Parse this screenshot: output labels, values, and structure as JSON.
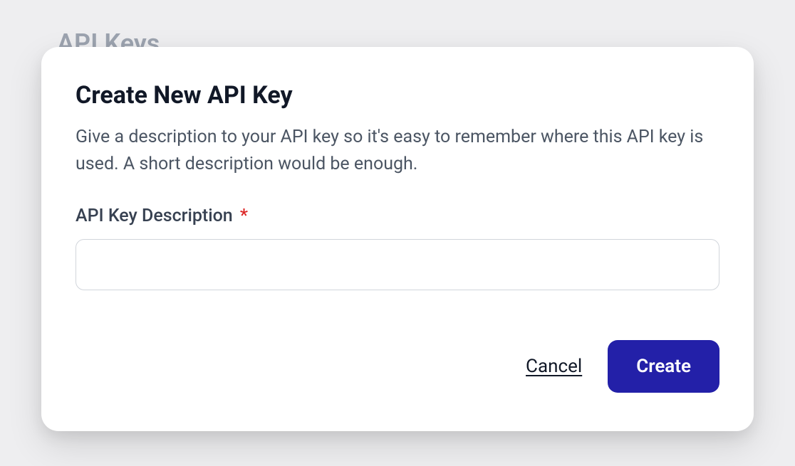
{
  "page": {
    "title": "API Keys"
  },
  "modal": {
    "title": "Create New API Key",
    "description": "Give a description to your API key so it's easy to remember where this API key is used. A short description would be enough.",
    "field": {
      "label": "API Key Description",
      "required_mark": "*",
      "value": "",
      "placeholder": ""
    },
    "buttons": {
      "cancel": "Cancel",
      "create": "Create"
    }
  },
  "colors": {
    "primary": "#2320a8",
    "danger": "#dc2626",
    "text": "#111827",
    "muted": "#4b5563",
    "bg": "#eeeef0"
  }
}
